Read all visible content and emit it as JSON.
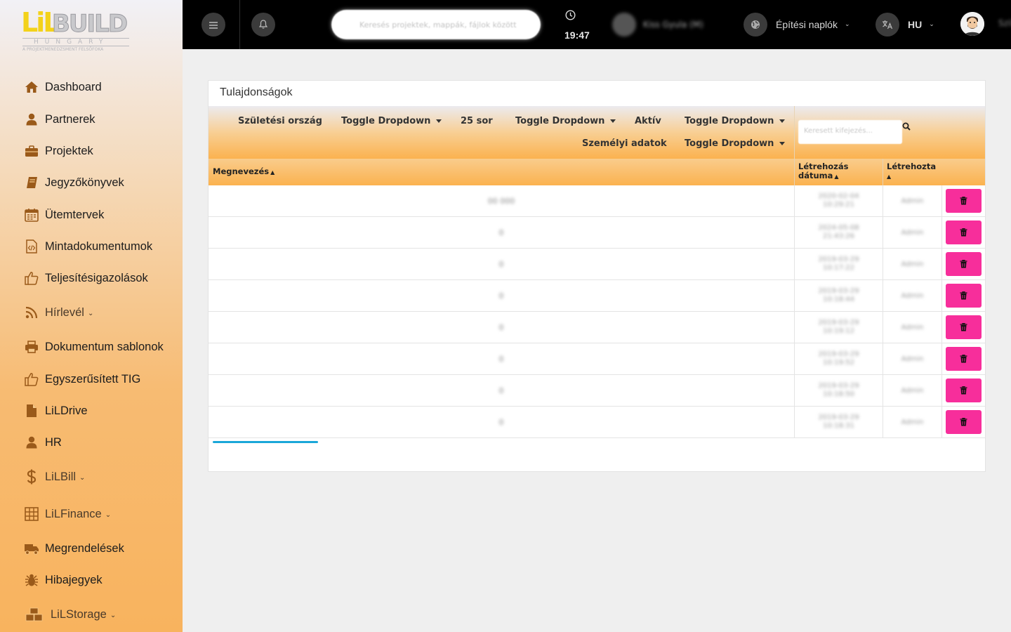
{
  "brand": {
    "lil": "LiL",
    "build": "BUILD",
    "hungary": "HUNGARY",
    "tagline": "A PROJEKTMENEDZSMENT FELSŐFOKA"
  },
  "sidebar": {
    "items": [
      {
        "label": "Dashboard",
        "icon": "home-icon"
      },
      {
        "label": "Partnerek",
        "icon": "user-icon"
      },
      {
        "label": "Projektek",
        "icon": "briefcase-icon"
      },
      {
        "label": "Jegyzőkönyvek",
        "icon": "book-icon"
      },
      {
        "label": "Ütemtervek",
        "icon": "calendar-icon"
      },
      {
        "label": "Mintadokumentumok",
        "icon": "code-file-icon"
      },
      {
        "label": "Teljesítésigazolások",
        "icon": "thumbs-up-icon"
      },
      {
        "label": "Hírlevél",
        "icon": "rss-icon",
        "dropdown": true
      },
      {
        "label": "Dokumentum sablonok",
        "icon": "printer-icon"
      },
      {
        "label": "Egyszerűsített TIG",
        "icon": "thumbs-up-icon"
      },
      {
        "label": "LiLDrive",
        "icon": "file-icon"
      },
      {
        "label": "HR",
        "icon": "user-icon"
      },
      {
        "label": "LiLBill",
        "icon": "dollar-icon",
        "dropdown": true
      },
      {
        "label": "LiLFinance",
        "icon": "calculator-icon",
        "dropdown": true
      },
      {
        "label": "Megrendelések",
        "icon": "truck-icon"
      },
      {
        "label": "Hibajegyek",
        "icon": "bug-icon"
      },
      {
        "label": "LiLStorage",
        "icon": "boxes-icon",
        "dropdown": true
      }
    ]
  },
  "topbar": {
    "search_placeholder": "Keresés projektek, mappák, fájlok között",
    "time": "19:47",
    "user_blur": "Kiss Gyula (M)",
    "logs_label": "Építési naplók",
    "lang": "HU",
    "user_name": "Szil"
  },
  "card": {
    "title": "Tulajdonságok",
    "toolbar": {
      "birth_country": "Születési ország",
      "toggle_1": "Toggle Dropdown",
      "rows": "25 sor",
      "toggle_2": "Toggle Dropdown",
      "active": "Aktív",
      "toggle_3": "Toggle Dropdown",
      "personal": "Személyi adatok",
      "toggle_4": "Toggle Dropdown",
      "search_placeholder": "Keresett kifejezés..."
    },
    "columns": {
      "name": "Megnevezés",
      "created_line1": "Létrehozás",
      "created_line2": "dátuma",
      "created_by": "Létrehozta"
    },
    "rows": [
      {
        "name": "00 000",
        "date": "2020-02-04",
        "time": "10:29:21",
        "by": "Admin"
      },
      {
        "name": "0",
        "date": "2024-05-08",
        "time": "21:43:26",
        "by": "Admin"
      },
      {
        "name": "0",
        "date": "2019-03-29",
        "time": "10:17:22",
        "by": "Admin"
      },
      {
        "name": "0",
        "date": "2019-03-29",
        "time": "10:18:44",
        "by": "Admin"
      },
      {
        "name": "0",
        "date": "2019-03-29",
        "time": "10:19:12",
        "by": "Admin"
      },
      {
        "name": "0",
        "date": "2019-03-29",
        "time": "10:19:52",
        "by": "Admin"
      },
      {
        "name": "0",
        "date": "2019-03-29",
        "time": "10:18:50",
        "by": "Admin"
      },
      {
        "name": "0",
        "date": "2019-03-29",
        "time": "10:18:31",
        "by": "Admin"
      }
    ]
  },
  "colors": {
    "accent": "#fbb24f",
    "delete": "#f72e9b",
    "topbar": "#000000",
    "scroll": "#1aa7d9"
  }
}
